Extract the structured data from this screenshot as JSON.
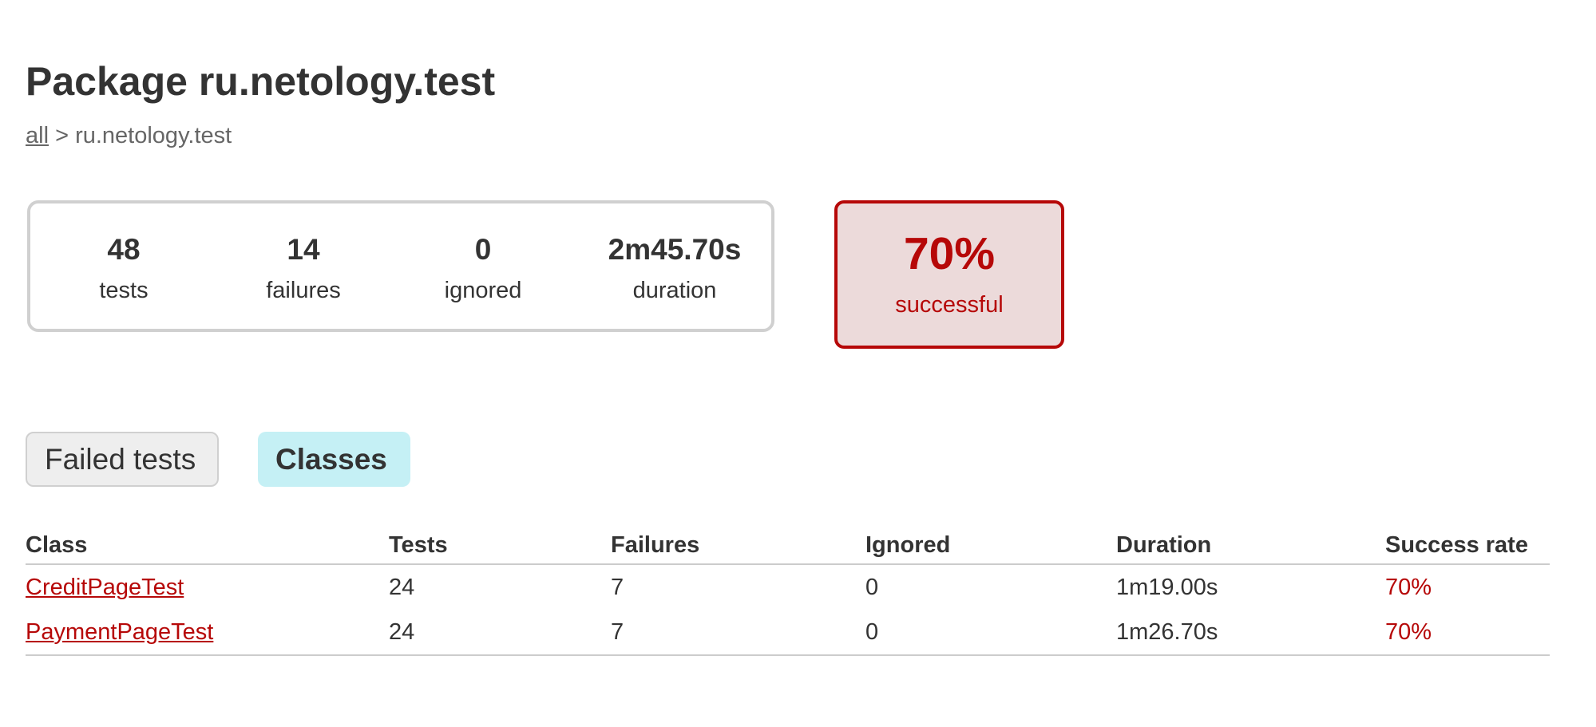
{
  "header": {
    "title": "Package ru.netology.test"
  },
  "breadcrumb": {
    "root_link": "all",
    "separator": ">",
    "current": "ru.netology.test"
  },
  "summary": {
    "tests": {
      "value": "48",
      "label": "tests"
    },
    "failures": {
      "value": "14",
      "label": "failures"
    },
    "ignored": {
      "value": "0",
      "label": "ignored"
    },
    "duration": {
      "value": "2m45.70s",
      "label": "duration"
    }
  },
  "success": {
    "rate": "70%",
    "label": "successful",
    "color": "#b60808",
    "background": "#ecdada"
  },
  "tabs": [
    {
      "label": "Failed tests",
      "selected": false
    },
    {
      "label": "Classes",
      "selected": true
    }
  ],
  "table": {
    "headers": [
      "Class",
      "Tests",
      "Failures",
      "Ignored",
      "Duration",
      "Success rate"
    ],
    "rows": [
      {
        "class": "CreditPageTest",
        "tests": "24",
        "failures": "7",
        "ignored": "0",
        "duration": "1m19.00s",
        "success_rate": "70%"
      },
      {
        "class": "PaymentPageTest",
        "tests": "24",
        "failures": "7",
        "ignored": "0",
        "duration": "1m26.70s",
        "success_rate": "70%"
      }
    ]
  },
  "colors": {
    "failure_accent": "#b60808",
    "selected_tab": "#c5f0f5",
    "text": "#333333"
  }
}
